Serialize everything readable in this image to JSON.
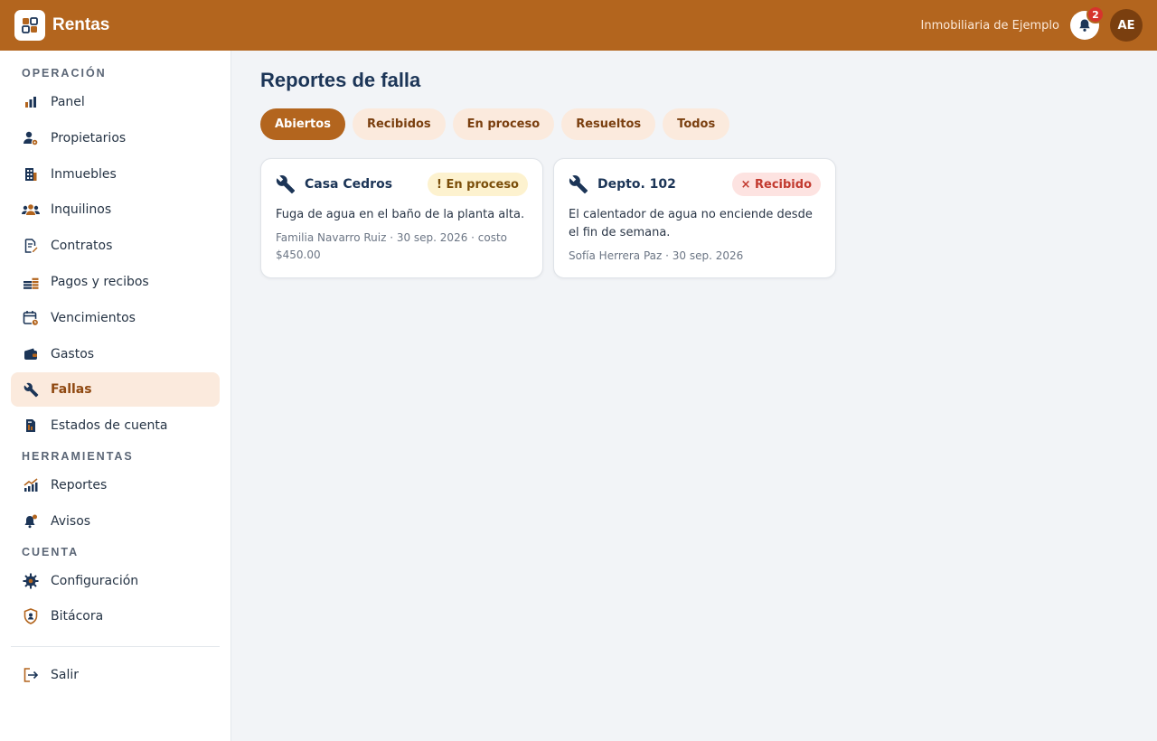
{
  "app": {
    "brand": "Rentas",
    "org_name": "Inmobiliaria de Ejemplo",
    "notif_count": "2",
    "avatar_initials": "AE"
  },
  "colors": {
    "primary": "#b3651e",
    "active_bg": "#fbeadd",
    "title": "#1c3557"
  },
  "sidebar": {
    "sections": [
      {
        "title": "OPERACIÓN",
        "items": [
          {
            "label": "Panel",
            "icon": "bar-chart-icon"
          },
          {
            "label": "Propietarios",
            "icon": "owner-icon"
          },
          {
            "label": "Inmuebles",
            "icon": "building-icon"
          },
          {
            "label": "Inquilinos",
            "icon": "tenants-icon"
          },
          {
            "label": "Contratos",
            "icon": "contract-icon"
          },
          {
            "label": "Pagos y recibos",
            "icon": "payments-icon"
          },
          {
            "label": "Vencimientos",
            "icon": "calendar-icon"
          },
          {
            "label": "Gastos",
            "icon": "wallet-icon"
          },
          {
            "label": "Fallas",
            "icon": "wrench-icon",
            "active": true
          },
          {
            "label": "Estados de cuenta",
            "icon": "statement-icon"
          }
        ]
      },
      {
        "title": "HERRAMIENTAS",
        "items": [
          {
            "label": "Reportes",
            "icon": "reports-icon"
          },
          {
            "label": "Avisos",
            "icon": "bell-icon"
          }
        ]
      },
      {
        "title": "CUENTA",
        "items": [
          {
            "label": "Configuración",
            "icon": "gear-icon"
          },
          {
            "label": "Bitácora",
            "icon": "shield-icon"
          }
        ]
      }
    ],
    "logout": "Salir"
  },
  "main": {
    "title": "Reportes de falla",
    "tabs": [
      {
        "label": "Abiertos",
        "active": true
      },
      {
        "label": "Recibidos"
      },
      {
        "label": "En proceso"
      },
      {
        "label": "Resueltos"
      },
      {
        "label": "Todos"
      }
    ],
    "cards": [
      {
        "title": "Casa Cedros",
        "status": "! En proceso",
        "description": "Fuga de agua en el baño de la planta alta.",
        "meta": "Familia Navarro Ruiz · 30 sep. 2026 · costo $450.00"
      },
      {
        "title": "Depto. 102",
        "status": "× Recibido",
        "description": "El calentador de agua no enciende desde el fin de semana.",
        "meta": "Sofía Herrera Paz · 30 sep. 2026"
      }
    ]
  }
}
